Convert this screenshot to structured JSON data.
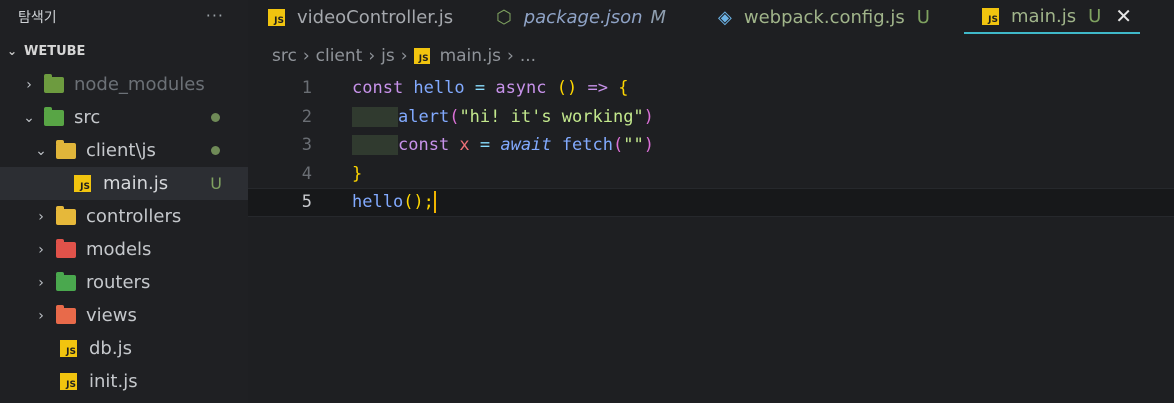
{
  "explorer": {
    "title": "탐색기",
    "more": "···",
    "root": "WETUBE",
    "items": [
      {
        "label": "node_modules"
      },
      {
        "label": "src"
      },
      {
        "label": "client\\js"
      },
      {
        "label": "main.js",
        "status": "U"
      },
      {
        "label": "controllers"
      },
      {
        "label": "models"
      },
      {
        "label": "routers"
      },
      {
        "label": "views"
      },
      {
        "label": "db.js"
      },
      {
        "label": "init.js"
      }
    ]
  },
  "tabs": [
    {
      "label": "videoController.js"
    },
    {
      "label": "package.json",
      "status": "M"
    },
    {
      "label": "webpack.config.js",
      "status": "U"
    },
    {
      "label": "main.js",
      "status": "U",
      "close": "✕"
    }
  ],
  "breadcrumb": [
    "src",
    "client",
    "js",
    "main.js",
    "..."
  ],
  "editor": {
    "line_numbers": [
      "1",
      "2",
      "3",
      "4",
      "5"
    ],
    "lines": [
      {
        "t": [
          "const",
          " hello",
          " =",
          " async",
          " ()",
          " =>",
          " {"
        ]
      },
      {
        "t": [
          "alert",
          "(",
          "\"hi! it's working\"",
          ")"
        ]
      },
      {
        "t": [
          "const",
          " x",
          " =",
          " await",
          " fetch",
          "(",
          "\"\"",
          ")"
        ]
      },
      {
        "t": [
          "}"
        ]
      },
      {
        "t": [
          "hello",
          "();"
        ]
      }
    ]
  },
  "colors": {
    "accent": "#3fb8c9",
    "untracked": "#7fa260",
    "js_icon": "#f1c40f"
  }
}
